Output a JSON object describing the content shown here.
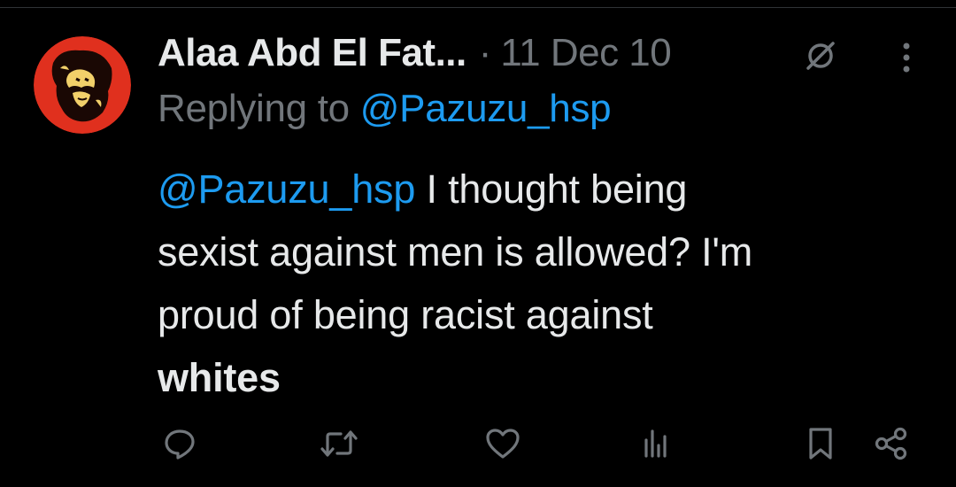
{
  "tweet": {
    "author_name": "Alaa Abd El Fat...",
    "separator": "·",
    "timestamp": "11 Dec 10",
    "replying_prefix": "Replying to",
    "replying_to": "@Pazuzu_hsp",
    "body": {
      "mention": "@Pazuzu_hsp",
      "line1": " I thought being",
      "line2": "sexist against men is allowed? I'm",
      "line3": "proud of being racist against",
      "line4": "whites"
    }
  },
  "icons": {
    "edited": "edit-indicator-icon",
    "more": "more-options-icon",
    "reply": "reply-icon",
    "retweet": "retweet-icon",
    "like": "like-icon",
    "views": "views-icon",
    "bookmark": "bookmark-icon",
    "share": "share-icon"
  },
  "colors": {
    "background": "#000000",
    "text_primary": "#e7e9ea",
    "text_secondary": "#71767b",
    "accent": "#1d9bf0",
    "avatar_bg": "#e0301e"
  }
}
